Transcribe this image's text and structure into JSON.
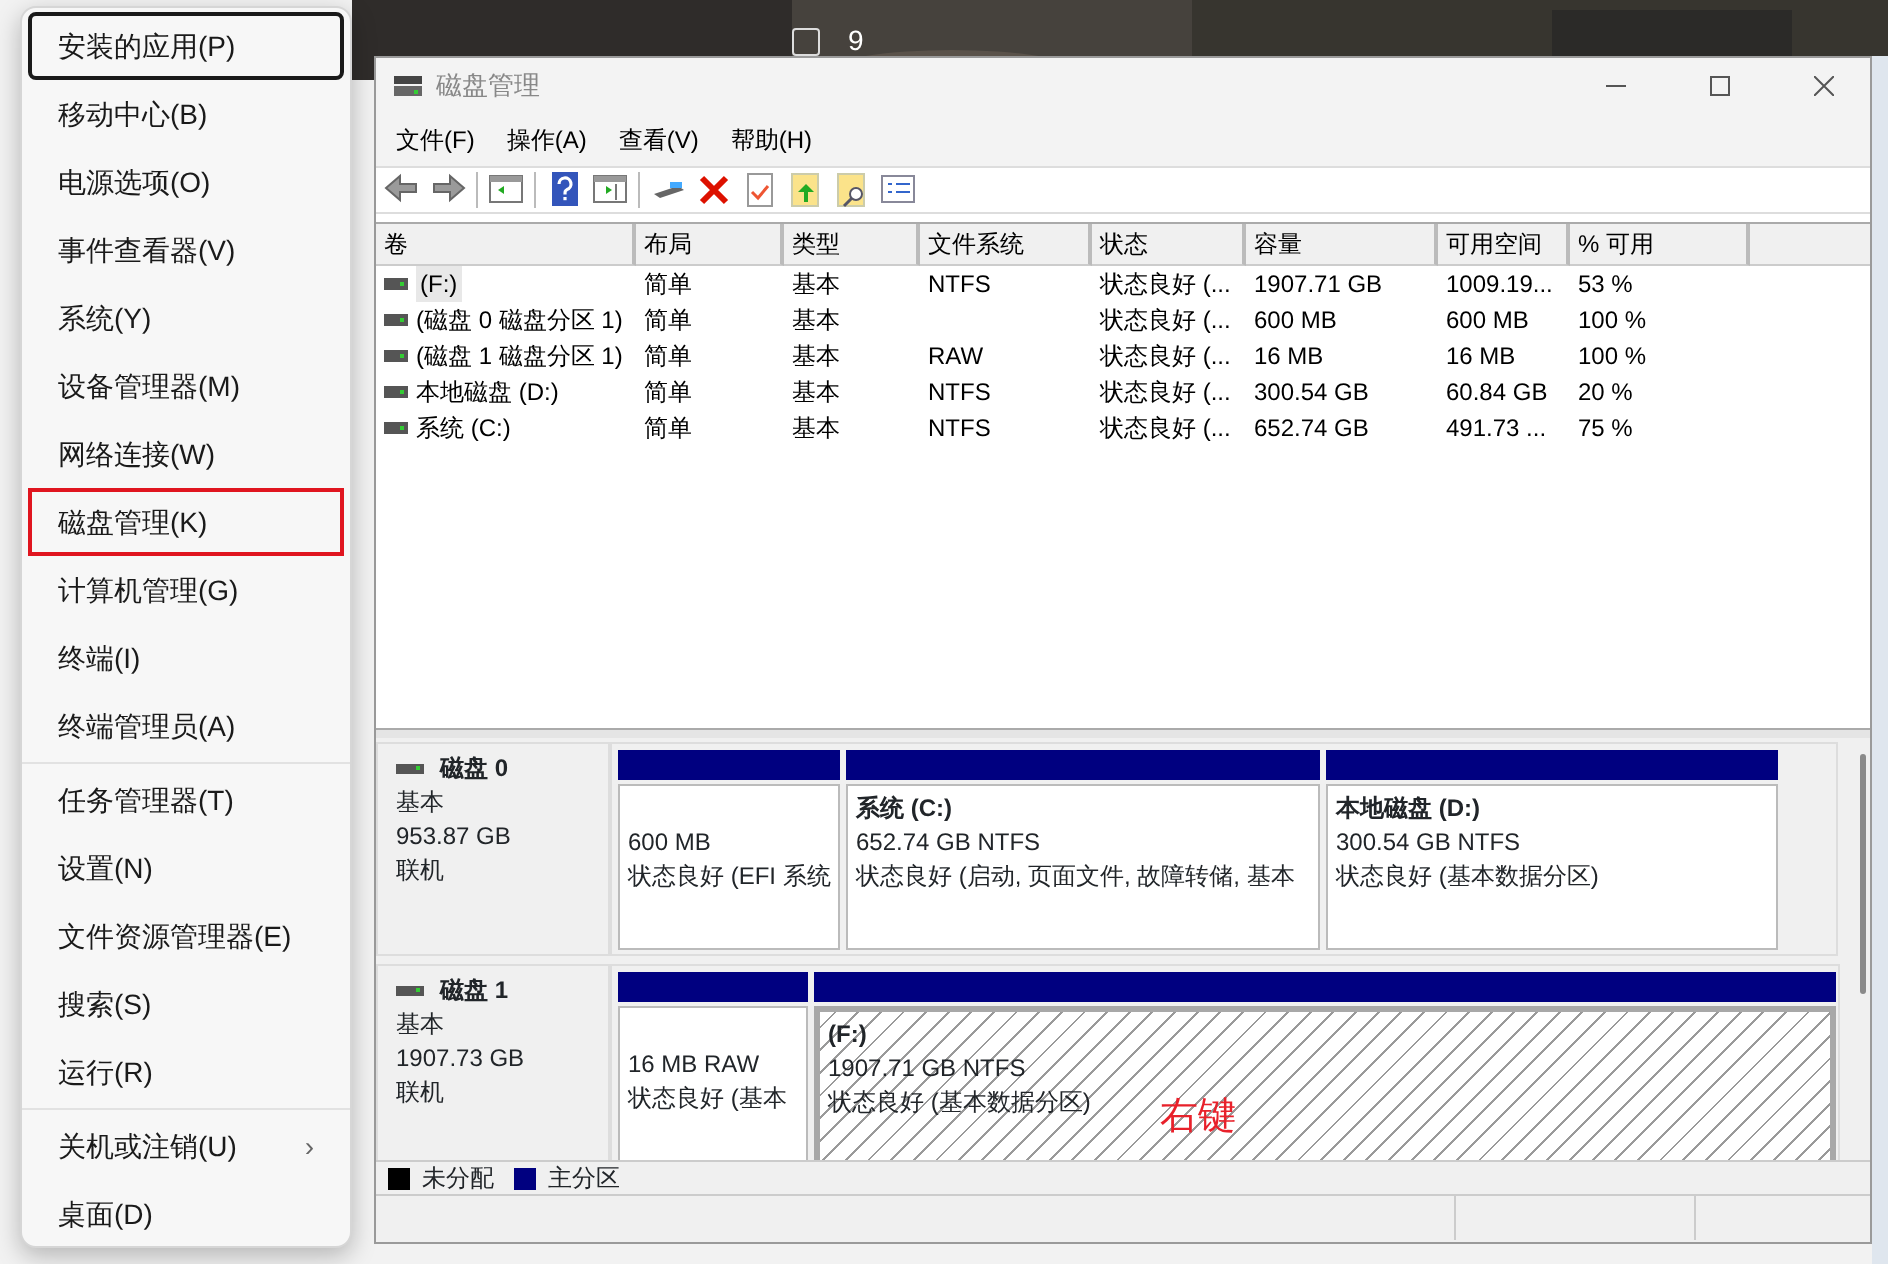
{
  "background": {
    "checkbox_label": "9",
    "checked": false
  },
  "start_menu": {
    "groups": [
      [
        {
          "label": "安装的应用(P)",
          "focused": true,
          "selected": false
        },
        {
          "label": "移动中心(B)",
          "focused": false,
          "selected": false
        },
        {
          "label": "电源选项(O)",
          "focused": false,
          "selected": false
        },
        {
          "label": "事件查看器(V)",
          "focused": false,
          "selected": false
        },
        {
          "label": "系统(Y)",
          "focused": false,
          "selected": false
        },
        {
          "label": "设备管理器(M)",
          "focused": false,
          "selected": false
        },
        {
          "label": "网络连接(W)",
          "focused": false,
          "selected": false
        },
        {
          "label": "磁盘管理(K)",
          "focused": false,
          "selected": true
        },
        {
          "label": "计算机管理(G)",
          "focused": false,
          "selected": false
        },
        {
          "label": "终端(I)",
          "focused": false,
          "selected": false
        },
        {
          "label": "终端管理员(A)",
          "focused": false,
          "selected": false
        }
      ],
      [
        {
          "label": "任务管理器(T)",
          "focused": false,
          "selected": false
        },
        {
          "label": "设置(N)",
          "focused": false,
          "selected": false
        },
        {
          "label": "文件资源管理器(E)",
          "focused": false,
          "selected": false
        },
        {
          "label": "搜索(S)",
          "focused": false,
          "selected": false
        },
        {
          "label": "运行(R)",
          "focused": false,
          "selected": false
        }
      ],
      [
        {
          "label": "关机或注销(U)",
          "arrow": "›",
          "focused": false,
          "selected": false
        },
        {
          "label": "桌面(D)",
          "focused": false,
          "selected": false
        }
      ]
    ]
  },
  "window": {
    "title": "磁盘管理",
    "menu": [
      "文件(F)",
      "操作(A)",
      "查看(V)",
      "帮助(H)"
    ],
    "table": {
      "columns": [
        "卷",
        "布局",
        "类型",
        "文件系统",
        "状态",
        "容量",
        "可用空间",
        "% 可用"
      ],
      "rows": [
        {
          "cells": [
            "(F:)",
            "简单",
            "基本",
            "NTFS",
            "状态良好 (...",
            "1907.71 GB",
            "1009.19...",
            "53 %"
          ],
          "selected": true
        },
        {
          "cells": [
            "(磁盘 0 磁盘分区 1)",
            "简单",
            "基本",
            "",
            "状态良好 (...",
            "600 MB",
            "600 MB",
            "100 %"
          ],
          "selected": false
        },
        {
          "cells": [
            "(磁盘 1 磁盘分区 1)",
            "简单",
            "基本",
            "RAW",
            "状态良好 (...",
            "16 MB",
            "16 MB",
            "100 %"
          ],
          "selected": false
        },
        {
          "cells": [
            "本地磁盘 (D:)",
            "简单",
            "基本",
            "NTFS",
            "状态良好 (...",
            "300.54 GB",
            "60.84 GB",
            "20 %"
          ],
          "selected": false
        },
        {
          "cells": [
            "系统 (C:)",
            "简单",
            "基本",
            "NTFS",
            "状态良好 (...",
            "652.74 GB",
            "491.73 ...",
            "75 %"
          ],
          "selected": false
        }
      ]
    },
    "disks": [
      {
        "name": "磁盘 0",
        "type": "基本",
        "size": "953.87 GB",
        "status": "联机",
        "partitions": [
          {
            "size_fs": "600 MB",
            "status": "状态良好 (EFI 系统",
            "selected": false
          },
          {
            "label": "系统  (C:)",
            "size_fs": "652.74 GB NTFS",
            "status": "状态良好 (启动, 页面文件, 故障转储, 基本",
            "selected": false
          },
          {
            "label": "本地磁盘  (D:)",
            "size_fs": "300.54 GB NTFS",
            "status": "状态良好 (基本数据分区)",
            "selected": false
          }
        ]
      },
      {
        "name": "磁盘 1",
        "type": "基本",
        "size": "1907.73 GB",
        "status": "联机",
        "partitions": [
          {
            "size_fs": "16 MB RAW",
            "status": "状态良好 (基本",
            "selected": false
          },
          {
            "label": "(F:)",
            "size_fs": "1907.71 GB NTFS",
            "status": "状态良好 (基本数据分区)",
            "selected": true,
            "note": "右键"
          }
        ]
      }
    ],
    "legend": [
      {
        "label": "未分配",
        "color": "#000000"
      },
      {
        "label": "主分区",
        "color": "#000080"
      }
    ]
  }
}
